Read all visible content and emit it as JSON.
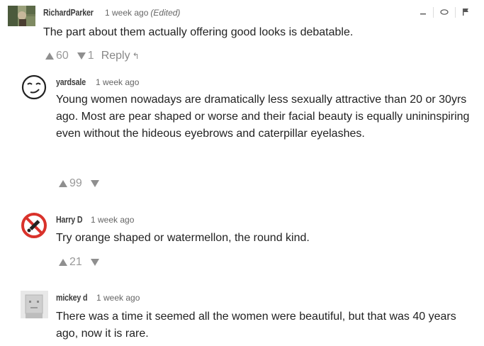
{
  "comments": [
    {
      "author": "RichardParker",
      "time": "1 week ago",
      "edited": "(Edited)",
      "text": "The part about them actually offering good looks is debatable.",
      "upvotes": "60",
      "downvotes": "1",
      "reply_label": "Reply",
      "avatar_icon": "photo-avatar",
      "tools": [
        "minimize-icon",
        "watch-icon",
        "flag-icon"
      ]
    },
    {
      "author": "yardsale",
      "time": "1 week ago",
      "text": "Young women nowadays are dramatically less sexually attractive than 20 or 30yrs ago.  Most are pear shaped or worse and their facial beauty is equally unininspiring even without the hideous eyebrows and caterpillar eyelashes.",
      "upvotes": "99",
      "avatar_icon": "smirk-face-icon"
    },
    {
      "author": "Harry D",
      "time": "1 week ago",
      "text": "Try orange shaped or watermellon, the round kind.",
      "upvotes": "21",
      "avatar_icon": "no-sign-icon"
    },
    {
      "author": "mickey d",
      "time": "1 week ago",
      "text": "There was a time it seemed all the women were beautiful, but that was 40 years ago, now it is rare.",
      "avatar_icon": "block-face-icon"
    }
  ],
  "colors": {
    "vote_gray": "#999999",
    "avatar_red": "#d9322b"
  }
}
